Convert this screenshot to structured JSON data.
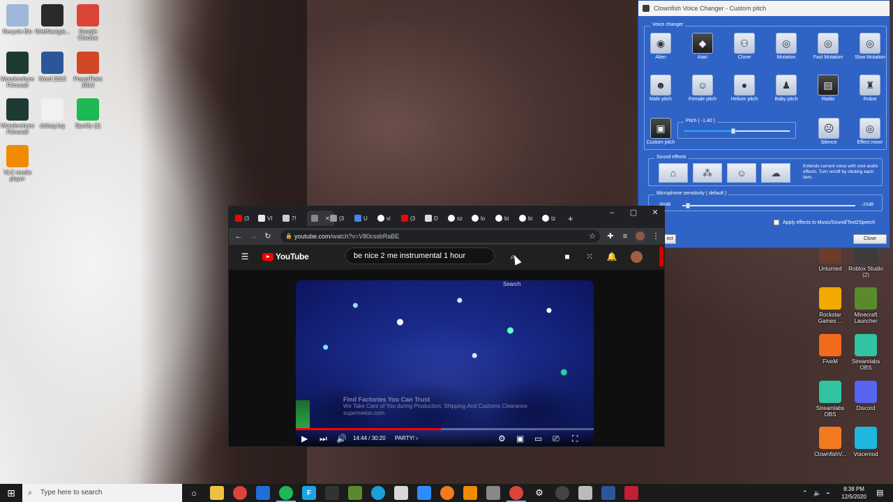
{
  "desktop": {
    "left_icons": [
      {
        "label": "Recycle Bin",
        "icon": "recycle-bin-icon",
        "color": "#9fb7d9"
      },
      {
        "label": "WebNavigat...",
        "icon": "globe-icon",
        "color": "#2a2a2a"
      },
      {
        "label": "Google Chrome",
        "icon": "chrome-icon",
        "color": "#db4437"
      },
      {
        "label": "Wondershare Filmora9",
        "icon": "filmora-icon",
        "color": "#1e3a34"
      },
      {
        "label": "Word 2013",
        "icon": "word-icon",
        "color": "#2b579a"
      },
      {
        "label": "PowerPoint 2013",
        "icon": "powerpoint-icon",
        "color": "#d24726"
      },
      {
        "label": "Wondershare Filmora9",
        "icon": "filmora-icon",
        "color": "#1e3a34"
      },
      {
        "label": "debug.log",
        "icon": "text-file-icon",
        "color": "#f1f1f1"
      },
      {
        "label": "Spotify (1)",
        "icon": "spotify-icon",
        "color": "#1db954"
      },
      {
        "label": "VLC media player",
        "icon": "vlc-icon",
        "color": "#f08a00"
      }
    ],
    "right_icons": [
      {
        "label": "Unturned",
        "icon": "unturned-icon",
        "color": "#6b3d2a"
      },
      {
        "label": "Roblox Studio (2)",
        "icon": "roblox-icon",
        "color": "#3b3b3b"
      },
      {
        "label": "Rockstar Games ...",
        "icon": "rockstar-icon",
        "color": "#f2a900"
      },
      {
        "label": "Minecraft Launcher",
        "icon": "minecraft-icon",
        "color": "#5b8a2e"
      },
      {
        "label": "FiveM",
        "icon": "fivem-icon",
        "color": "#f26a1b"
      },
      {
        "label": "Streamlabs OBS",
        "icon": "streamlabs-icon",
        "color": "#31c3a2"
      },
      {
        "label": "Streamlabs OBS",
        "icon": "streamlabs-icon",
        "color": "#31c3a2"
      },
      {
        "label": "Discord",
        "icon": "discord-icon",
        "color": "#5865f2"
      },
      {
        "label": "ClownfishV...",
        "icon": "clownfish-icon",
        "color": "#f47a20"
      },
      {
        "label": "Voicemod",
        "icon": "voicemod-icon",
        "color": "#1fb6e0"
      }
    ]
  },
  "clownfish": {
    "title": "Clownfish Voice Changer - Custom pitch",
    "voice_changer_label": "Voice changer",
    "effects_row1": [
      "Alien",
      "Atari",
      "Clone",
      "Mutation",
      "Fast Mutation",
      "Slow Mutation"
    ],
    "effects_row2": [
      "Male pitch",
      "Female pitch",
      "Helium pitch",
      "Baby pitch",
      "Radio",
      "Robot"
    ],
    "custom_pitch": "Custom pitch",
    "pitch_label": "Pitch ( -1.40 )",
    "pitch_fraction": 0.47,
    "silence": "Silence",
    "effect_mixer": "Effect mixer",
    "sound_effects_label": "Sound effects",
    "sound_effects_help": "Extends current voice with cool audio effects. Turn on/off by clicking each item.",
    "mic_sensitivity_label": "Microphone sensitivity ( default )",
    "mic_min": "-60dB",
    "mic_max": "-20dB",
    "mic_fraction": 0.02,
    "apply_label": "Apply effects to Music/Sound/Text2Speech",
    "left_button_partial": "ect",
    "close_button": "Close"
  },
  "chrome": {
    "tabs": [
      {
        "label": "(3",
        "icon": "youtube-favicon",
        "color": "#ff0000"
      },
      {
        "label": "VI",
        "icon": "vr-favicon",
        "color": "#e8e8e8"
      },
      {
        "label": "7!",
        "icon": "site-favicon",
        "color": "#cccccc"
      },
      {
        "label": "",
        "icon": "audio-tab-icon",
        "color": "#888888"
      },
      {
        "label": "(3",
        "icon": "site-favicon",
        "color": "#9a9a9a"
      },
      {
        "label": "U",
        "icon": "docs-favicon",
        "color": "#4285f4"
      },
      {
        "label": "vi",
        "icon": "google-favicon",
        "color": "#ffffff"
      },
      {
        "label": "(3",
        "icon": "youtube-favicon",
        "color": "#ff0000"
      },
      {
        "label": "D",
        "icon": "download-favicon",
        "color": "#dddddd"
      },
      {
        "label": "sz",
        "icon": "google-favicon",
        "color": "#ffffff"
      },
      {
        "label": "lo",
        "icon": "google-favicon",
        "color": "#ffffff"
      },
      {
        "label": "bi",
        "icon": "google-favicon",
        "color": "#ffffff"
      },
      {
        "label": "bi",
        "icon": "google-favicon",
        "color": "#ffffff"
      },
      {
        "label": "tz",
        "icon": "google-favicon",
        "color": "#ffffff"
      }
    ],
    "new_tab": "+",
    "url_host": "youtube.com",
    "url_path": "/watch?v=V80cssbRaBE"
  },
  "youtube": {
    "logo_text": "YouTube",
    "search_value": "be nice 2 me instrumental 1 hour",
    "search_tooltip": "Search",
    "ad_title": "Find Factories You Can Trust",
    "ad_line": "We Take Care of You during Production, Shipping And Customs Clearance",
    "ad_domain": "supermelon.com",
    "time": "14:44 / 30:20",
    "chapter": "PARTY!",
    "progress_fraction": 0.486,
    "accent": "#ff0000"
  },
  "taskbar": {
    "search_placeholder": "Type here to search",
    "time": "8:38 PM",
    "date": "12/5/2020"
  }
}
